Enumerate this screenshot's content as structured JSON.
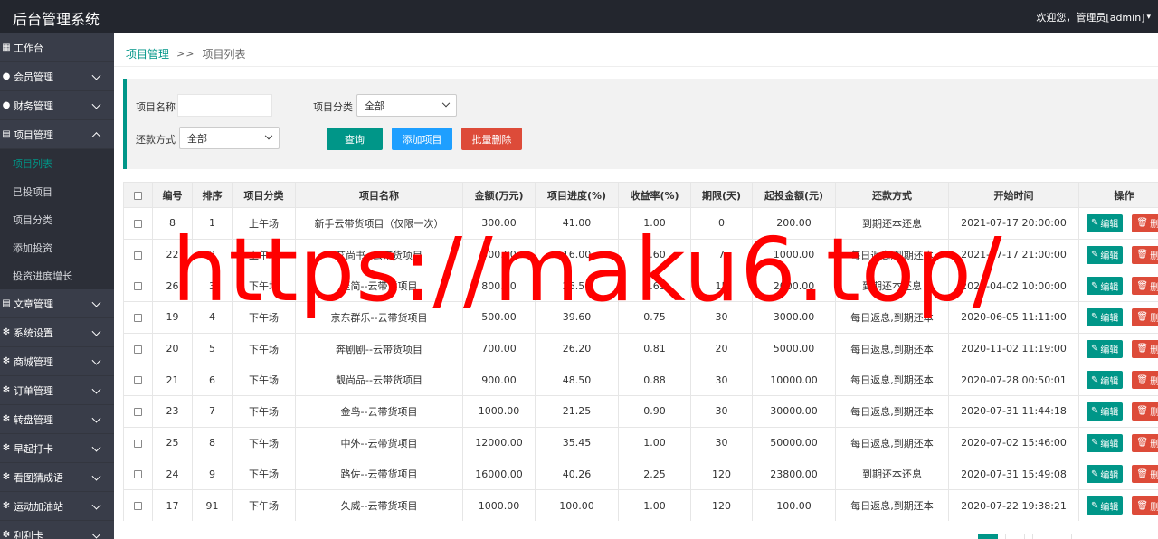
{
  "app": {
    "title": "后台管理系统",
    "user_greeting": "欢迎您，管理员[admin]"
  },
  "sidebar": {
    "items": [
      {
        "label": "工作台",
        "icon": "home-icon"
      },
      {
        "label": "会员管理",
        "icon": "user-icon"
      },
      {
        "label": "财务管理",
        "icon": "money-icon"
      },
      {
        "label": "项目管理",
        "icon": "list-icon"
      },
      {
        "label": "文章管理",
        "icon": "doc-icon"
      },
      {
        "label": "系统设置",
        "icon": "gear-icon"
      },
      {
        "label": "商城管理",
        "icon": "gear-icon"
      },
      {
        "label": "订单管理",
        "icon": "gear-icon"
      },
      {
        "label": "转盘管理",
        "icon": "gear-icon"
      },
      {
        "label": "早起打卡",
        "icon": "gear-icon"
      },
      {
        "label": "看图猜成语",
        "icon": "gear-icon"
      },
      {
        "label": "运动加油站",
        "icon": "gear-icon"
      },
      {
        "label": "利利卡",
        "icon": "gear-icon"
      }
    ],
    "project_sub": [
      "项目列表",
      "已投项目",
      "项目分类",
      "添加投资",
      "投资进度增长"
    ]
  },
  "breadcrumb": {
    "parent": "项目管理",
    "sep": ">>",
    "current": "项目列表"
  },
  "search": {
    "name_label": "项目名称",
    "name_value": "",
    "category_label": "项目分类",
    "category_value": "全部",
    "repay_label": "还款方式",
    "repay_value": "全部",
    "query_btn": "查询",
    "add_btn": "添加项目",
    "batch_delete_btn": "批量删除"
  },
  "table": {
    "headers": [
      "编号",
      "排序",
      "项目分类",
      "项目名称",
      "金额(万元)",
      "项目进度(%)",
      "收益率(%)",
      "期限(天)",
      "起投金额(元)",
      "还款方式",
      "开始时间",
      "操作"
    ],
    "edit_label": "编辑",
    "delete_label": "删除",
    "rows": [
      [
        "8",
        "1",
        "上午场",
        "新手云带货项目（仅限一次）",
        "300.00",
        "41.00",
        "1.00",
        "0",
        "200.00",
        "到期还本还息",
        "2021-07-17 20:00:00"
      ],
      [
        "22",
        "2",
        "上午场",
        "艾尚书--云带货项目",
        "500.00",
        "16.00",
        "0.60",
        "7",
        "1000.00",
        "每日返息,到期还本",
        "2021-07-17 21:00:00"
      ],
      [
        "26",
        "3",
        "下午场",
        "至简--云带货项目",
        "800.00",
        "26.50",
        "0.63",
        "15",
        "2000.00",
        "到期还本还息",
        "2020-04-02 10:00:00"
      ],
      [
        "19",
        "4",
        "下午场",
        "京东群乐--云带货项目",
        "500.00",
        "39.60",
        "0.75",
        "30",
        "3000.00",
        "每日返息,到期还本",
        "2020-06-05 11:11:00"
      ],
      [
        "20",
        "5",
        "下午场",
        "奔剧剧--云带货项目",
        "700.00",
        "26.20",
        "0.81",
        "20",
        "5000.00",
        "每日返息,到期还本",
        "2020-11-02 11:19:00"
      ],
      [
        "21",
        "6",
        "下午场",
        "靓尚品--云带货项目",
        "900.00",
        "48.50",
        "0.88",
        "30",
        "10000.00",
        "每日返息,到期还本",
        "2020-07-28 00:50:01"
      ],
      [
        "23",
        "7",
        "下午场",
        "金鸟--云带货项目",
        "1000.00",
        "21.25",
        "0.90",
        "30",
        "30000.00",
        "每日返息,到期还本",
        "2020-07-31 11:44:18"
      ],
      [
        "25",
        "8",
        "下午场",
        "中外--云带货项目",
        "12000.00",
        "35.45",
        "1.00",
        "30",
        "50000.00",
        "每日返息,到期还本",
        "2020-07-02 15:46:00"
      ],
      [
        "24",
        "9",
        "下午场",
        "路佐--云带货项目",
        "16000.00",
        "40.26",
        "2.25",
        "120",
        "23800.00",
        "到期还本还息",
        "2020-07-31 15:49:08"
      ],
      [
        "17",
        "91",
        "下午场",
        "久威--云带货项目",
        "1000.00",
        "100.00",
        "1.00",
        "120",
        "100.00",
        "每日返息,到期还本",
        "2020-07-22 19:38:21"
      ]
    ]
  },
  "watermark": "https://maku6.top/",
  "colors": {
    "accent": "#009688",
    "blue": "#1e9fff",
    "danger": "#dd4b39",
    "sidebar": "#393d49",
    "topbar": "#23262e",
    "watermark": "#ff0000"
  }
}
